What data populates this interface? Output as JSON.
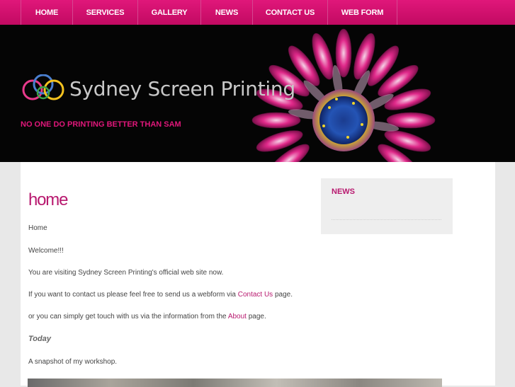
{
  "nav": {
    "items": [
      {
        "label": "HOME"
      },
      {
        "label": "SERVICES"
      },
      {
        "label": "GALLERY"
      },
      {
        "label": "NEWS"
      },
      {
        "label": "CONTACT US"
      },
      {
        "label": "WEB FORM"
      }
    ]
  },
  "banner": {
    "logo_text": "Sydney Screen Printing",
    "tagline": "NO ONE DO PRINTING BETTER THAN SAM"
  },
  "main": {
    "title": "home",
    "breadcrumb": "Home",
    "welcome": "Welcome!!!",
    "visiting": "You are visiting Sydney Screen Printing's official web site now.",
    "contact_pre": "If you want to contact us please feel free to send us a webform via ",
    "contact_link": "Contact Us",
    "contact_post": " page.",
    "about_pre": "or you can simply get touch with us via the information from the ",
    "about_link": "About",
    "about_post": " page.",
    "today": "Today",
    "snapshot": "A snapshot of my workshop."
  },
  "sidebar": {
    "news_title": "NEWS"
  },
  "colors": {
    "accent": "#e0177a",
    "link": "#b8196f",
    "background": "#e8e8e8"
  }
}
